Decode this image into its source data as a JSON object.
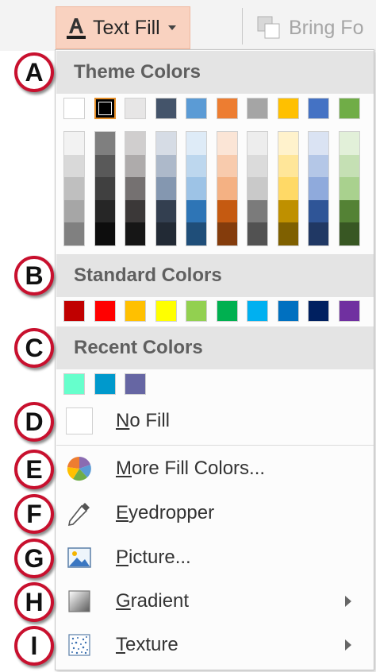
{
  "ribbon": {
    "text_fill_label": "Text Fill",
    "bring_forward_label": "Bring Fo"
  },
  "sections": {
    "theme_colors": "Theme Colors",
    "standard_colors": "Standard Colors",
    "recent_colors": "Recent Colors"
  },
  "theme_colors": [
    {
      "base": "#ffffff",
      "shades": [
        "#f2f2f2",
        "#d9d9d9",
        "#bfbfbf",
        "#a6a6a6",
        "#808080"
      ]
    },
    {
      "base": "#000000",
      "shades": [
        "#7f7f7f",
        "#595959",
        "#404040",
        "#262626",
        "#0d0d0d"
      ]
    },
    {
      "base": "#e7e6e6",
      "shades": [
        "#d0cece",
        "#aeabab",
        "#757171",
        "#3b3838",
        "#161616"
      ]
    },
    {
      "base": "#44546a",
      "shades": [
        "#d6dce5",
        "#adb9ca",
        "#8497b0",
        "#333f50",
        "#222a35"
      ]
    },
    {
      "base": "#5b9bd5",
      "shades": [
        "#deebf7",
        "#bdd7ee",
        "#9dc3e6",
        "#2e75b6",
        "#1f4e79"
      ]
    },
    {
      "base": "#ed7d31",
      "shades": [
        "#fbe5d6",
        "#f8cbad",
        "#f4b183",
        "#c55a11",
        "#843c0c"
      ]
    },
    {
      "base": "#a5a5a5",
      "shades": [
        "#ededed",
        "#dbdbdb",
        "#c9c9c9",
        "#7b7b7b",
        "#525252"
      ]
    },
    {
      "base": "#ffc000",
      "shades": [
        "#fff2cc",
        "#ffe699",
        "#ffd966",
        "#bf9000",
        "#7f6000"
      ]
    },
    {
      "base": "#4472c4",
      "shades": [
        "#dae3f3",
        "#b4c7e7",
        "#8faadc",
        "#2f5597",
        "#203864"
      ]
    },
    {
      "base": "#70ad47",
      "shades": [
        "#e2f0d9",
        "#c5e0b4",
        "#a9d18e",
        "#548235",
        "#385723"
      ]
    }
  ],
  "selected_theme_index": 1,
  "standard_colors": [
    "#c00000",
    "#ff0000",
    "#ffc000",
    "#ffff00",
    "#92d050",
    "#00b050",
    "#00b0f0",
    "#0070c0",
    "#002060",
    "#7030a0"
  ],
  "recent_colors": [
    "#66ffcc",
    "#0099cc",
    "#6666a3"
  ],
  "menu": {
    "no_fill": {
      "accel": "N",
      "rest": "o Fill"
    },
    "more_fill_colors": {
      "accel": "M",
      "rest": "ore Fill Colors..."
    },
    "eyedropper": {
      "accel": "E",
      "rest": "yedropper"
    },
    "picture": {
      "accel": "P",
      "rest": "icture..."
    },
    "gradient": {
      "accel": "G",
      "rest": "radient"
    },
    "texture": {
      "accel": "T",
      "rest": "exture"
    }
  },
  "callouts": [
    "A",
    "B",
    "C",
    "D",
    "E",
    "F",
    "G",
    "H",
    "I"
  ],
  "colors": {
    "accent_highlight": "#f9d2c0",
    "callout_ring": "#c8102e",
    "selection_border": "#e48d27"
  }
}
